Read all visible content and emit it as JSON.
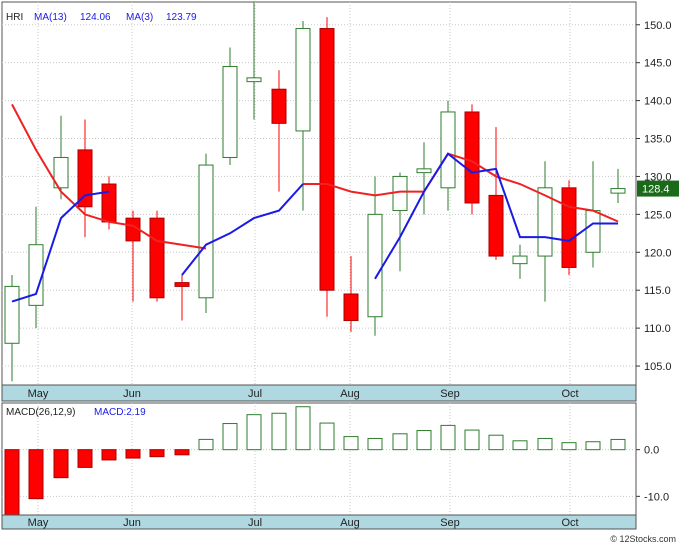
{
  "chart_data": [
    {
      "type": "candlestick",
      "ticker": "HRI",
      "legend": [
        {
          "text": "HRI",
          "color": "#222222"
        },
        {
          "text": "MA(13)",
          "color": "#1a1ae6"
        },
        {
          "text": "124.06",
          "color": "#1a1ae6"
        },
        {
          "text": "MA(3)",
          "color": "#1a1ae6"
        },
        {
          "text": "123.79",
          "color": "#1a1ae6"
        }
      ],
      "ylim": [
        102.5,
        153
      ],
      "y_ticks": [
        105.0,
        110.0,
        115.0,
        120.0,
        125.0,
        130.0,
        135.0,
        140.0,
        145.0,
        150.0
      ],
      "last_price": "128.4",
      "x_labels": [
        "May",
        "Jun",
        "Jul",
        "Aug",
        "Sep",
        "Oct"
      ],
      "colors": {
        "up": "#2e7d2e",
        "down": "#ff0000",
        "ma13": "#ee2222",
        "ma3": "#1a1ae6",
        "axis_band": "#b0d8e0",
        "price_tag": "#1a6a1a"
      },
      "candles": [
        {
          "o": 108,
          "h": 117,
          "l": 103,
          "c": 115.5
        },
        {
          "o": 113,
          "h": 126,
          "l": 110,
          "c": 121
        },
        {
          "o": 128.5,
          "h": 138,
          "l": 127,
          "c": 132.5
        },
        {
          "o": 133.5,
          "h": 137.5,
          "l": 122,
          "c": 126
        },
        {
          "o": 129,
          "h": 130,
          "l": 123,
          "c": 124
        },
        {
          "o": 124.5,
          "h": 125.5,
          "l": 113.5,
          "c": 121.5
        },
        {
          "o": 124.5,
          "h": 125.5,
          "l": 113.5,
          "c": 114
        },
        {
          "o": 116,
          "h": 117,
          "l": 111,
          "c": 115.5
        },
        {
          "o": 114,
          "h": 133,
          "l": 112,
          "c": 131.5
        },
        {
          "o": 132.5,
          "h": 147,
          "l": 131.5,
          "c": 144.5
        },
        {
          "o": 142.5,
          "h": 153,
          "l": 137.5,
          "c": 143
        },
        {
          "o": 141.5,
          "h": 144,
          "l": 128,
          "c": 137
        },
        {
          "o": 136,
          "h": 150.5,
          "l": 125.5,
          "c": 149.5
        },
        {
          "o": 149.5,
          "h": 151,
          "l": 111.5,
          "c": 115
        },
        {
          "o": 114.5,
          "h": 119.5,
          "l": 109.5,
          "c": 111
        },
        {
          "o": 111.5,
          "h": 130,
          "l": 109,
          "c": 125
        },
        {
          "o": 125.5,
          "h": 130.5,
          "l": 117.5,
          "c": 130
        },
        {
          "o": 130.5,
          "h": 134.5,
          "l": 125,
          "c": 131
        },
        {
          "o": 128.5,
          "h": 140,
          "l": 125.5,
          "c": 138.5
        },
        {
          "o": 138.5,
          "h": 139.5,
          "l": 125,
          "c": 126.5
        },
        {
          "o": 127.5,
          "h": 136.5,
          "l": 119,
          "c": 119.5
        },
        {
          "o": 118.5,
          "h": 121,
          "l": 116.5,
          "c": 119.5
        },
        {
          "o": 119.5,
          "h": 132,
          "l": 113.5,
          "c": 128.5
        },
        {
          "o": 128.5,
          "h": 129.5,
          "l": 117,
          "c": 118
        },
        {
          "o": 120,
          "h": 132,
          "l": 118,
          "c": 125.5
        },
        {
          "o": 127.8,
          "h": 131,
          "l": 126.5,
          "c": 128.4
        }
      ],
      "ma13": [
        139.5,
        133.5,
        128,
        125,
        124,
        123.5,
        121.5,
        121,
        120.5,
        null,
        null,
        null,
        129,
        129,
        128,
        127.5,
        128,
        128,
        133,
        132,
        130,
        129,
        127.5,
        126,
        125.5,
        124.06
      ],
      "ma3": [
        113.5,
        114.5,
        124.5,
        127.5,
        128,
        null,
        null,
        117,
        121,
        122.5,
        124.5,
        125.5,
        129,
        null,
        null,
        116.5,
        122,
        128,
        133,
        130.5,
        131,
        122,
        122,
        121.5,
        123.8,
        123.79
      ]
    },
    {
      "type": "bar",
      "title": "MACD(26,12,9)",
      "legend": [
        {
          "text": "MACD(26,12,9)",
          "color": "#222222"
        },
        {
          "text": "MACD:2.19",
          "color": "#1a1ae6"
        }
      ],
      "ylim": [
        -14,
        10
      ],
      "y_ticks": [
        0.0,
        -10.0
      ],
      "x_labels": [
        "May",
        "Jun",
        "Jul",
        "Aug",
        "Sep",
        "Oct"
      ],
      "values": [
        -14,
        -10.5,
        -6,
        -3.8,
        -2.2,
        -1.8,
        -1.5,
        -1.1,
        2.2,
        5.6,
        7.5,
        7.8,
        9.2,
        5.7,
        2.8,
        2.4,
        3.4,
        4.1,
        5.2,
        4.2,
        3.1,
        1.9,
        2.4,
        1.5,
        1.7,
        2.19
      ]
    }
  ],
  "credit": "© 12Stocks.com"
}
